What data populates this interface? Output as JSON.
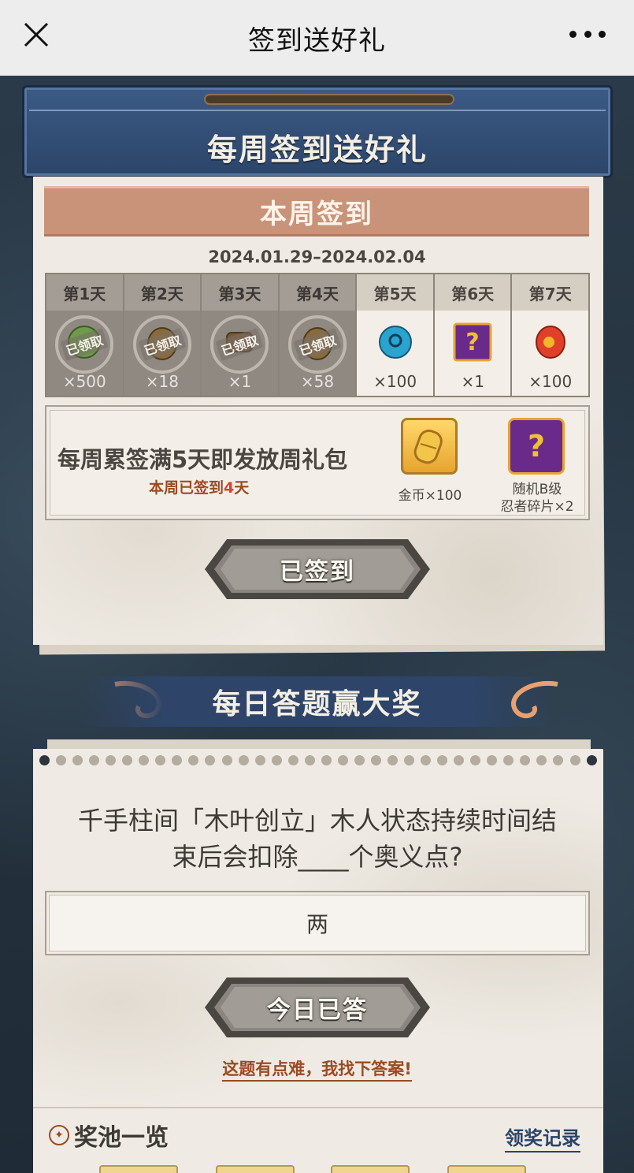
{
  "nav": {
    "title": "签到送好礼",
    "close_icon": "close-icon",
    "more_icon": "more-dots-icon"
  },
  "weekly": {
    "header_title": "每周签到送好礼",
    "banner": "本周签到",
    "date_range": "2024.01.29–2024.02.04",
    "claimed_stamp": "已领取",
    "days": [
      {
        "label": "第1天",
        "qty": "×500",
        "claimed": true,
        "icon": "green-leaf-item-icon",
        "color": "#6f9a4a"
      },
      {
        "label": "第2天",
        "qty": "×18",
        "claimed": true,
        "icon": "brown-pouch-item-icon",
        "color": "#8a6a3a"
      },
      {
        "label": "第3天",
        "qty": "×1",
        "claimed": true,
        "icon": "brown-scroll-item-icon",
        "color": "#7a5a3a"
      },
      {
        "label": "第4天",
        "qty": "×58",
        "claimed": true,
        "icon": "brown-pouch-item-icon",
        "color": "#8a6a3a"
      },
      {
        "label": "第5天",
        "qty": "×100",
        "claimed": false,
        "icon": "blue-orb-item-icon",
        "color": "#2aa3cf"
      },
      {
        "label": "第6天",
        "qty": "×1",
        "claimed": false,
        "icon": "mystery-fragment-icon",
        "color": "#6a2a8a"
      },
      {
        "label": "第7天",
        "qty": "×100",
        "claimed": false,
        "icon": "red-gem-item-icon",
        "color": "#e0402a"
      }
    ],
    "reward": {
      "main_text": "每周累签满5天即发放周礼包",
      "progress_prefix": "本周已签到",
      "progress_count": "4",
      "progress_suffix": "天",
      "items": [
        {
          "caption": "金币×100",
          "icon": "gold-coin-icon"
        },
        {
          "caption_line1": "随机B级",
          "caption_line2": "忍者碎片×2",
          "icon": "mystery-fragment-icon"
        }
      ]
    },
    "signed_button": "已签到"
  },
  "quiz": {
    "title": "每日答题赢大奖",
    "question_line1": "千手柱间「木叶创立」木人状态持续时间结",
    "question_line2": "束后会扣除____个奥义点?",
    "answer": "两",
    "answered_button": "今日已答",
    "hint": "这题有点难，我找下答案!",
    "pool_title": "奖池一览",
    "record_link": "领奖记录"
  },
  "colors": {
    "accent_blue": "#2c4569",
    "banner_salmon": "#c9937a",
    "highlight_red": "#e0402a",
    "hint_brown": "#9b4a22",
    "paper": "#efebe4"
  }
}
